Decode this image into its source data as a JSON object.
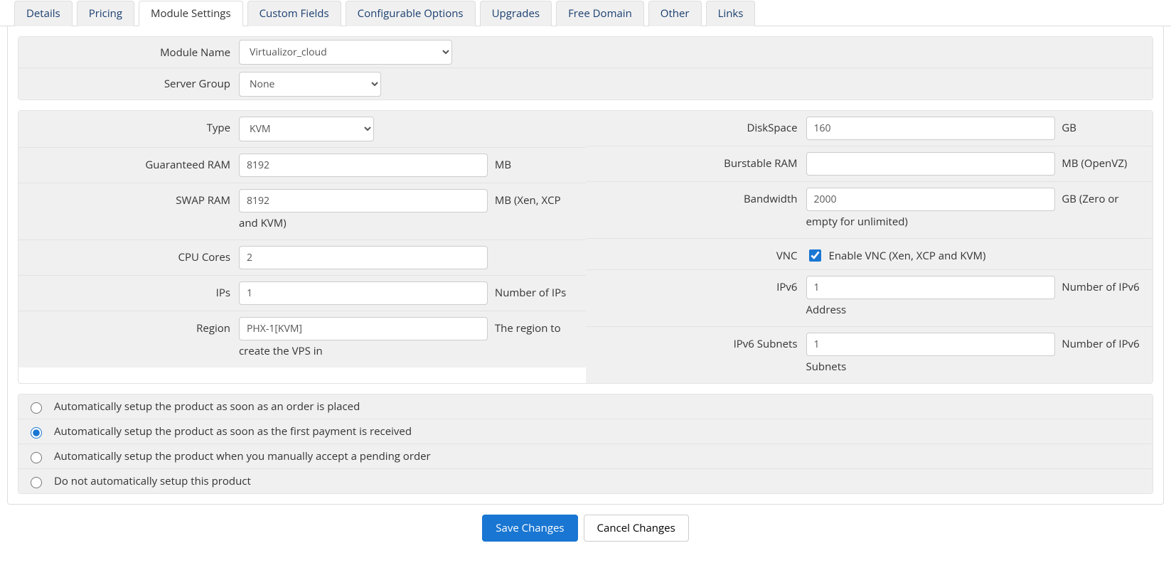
{
  "tabs": {
    "details": "Details",
    "pricing": "Pricing",
    "module": "Module Settings",
    "custom": "Custom Fields",
    "config": "Configurable Options",
    "upgrades": "Upgrades",
    "free_domain": "Free Domain",
    "other": "Other",
    "links": "Links"
  },
  "top": {
    "module_name_label": "Module Name",
    "module_name_value": "Virtualizor_cloud",
    "server_group_label": "Server Group",
    "server_group_value": "None"
  },
  "left": {
    "type_label": "Type",
    "type_value": "KVM",
    "gram_label": "Guaranteed RAM",
    "gram_value": "8192",
    "gram_suffix": "MB",
    "swap_label": "SWAP RAM",
    "swap_value": "8192",
    "swap_suffix": "MB (Xen, XCP and KVM)",
    "cpu_label": "CPU Cores",
    "cpu_value": "2",
    "ips_label": "IPs",
    "ips_value": "1",
    "ips_suffix": "Number of IPs",
    "region_label": "Region",
    "region_value": "PHX-1[KVM]",
    "region_suffix": "The region to create the VPS in"
  },
  "right": {
    "disk_label": "DiskSpace",
    "disk_value": "160",
    "disk_suffix": "GB",
    "bram_label": "Burstable RAM",
    "bram_value": "",
    "bram_suffix": "MB (OpenVZ)",
    "bw_label": "Bandwidth",
    "bw_value": "2000",
    "bw_suffix": "GB (Zero or empty for unlimited)",
    "vnc_label": "VNC",
    "vnc_checkbox_label": "Enable VNC (Xen, XCP and KVM)",
    "ipv6_label": "IPv6",
    "ipv6_value": "1",
    "ipv6_suffix": "Number of IPv6 Address",
    "ipv6s_label": "IPv6 Subnets",
    "ipv6s_value": "1",
    "ipv6s_suffix": "Number of IPv6 Subnets"
  },
  "radios": {
    "r1": "Automatically setup the product as soon as an order is placed",
    "r2": "Automatically setup the product as soon as the first payment is received",
    "r3": "Automatically setup the product when you manually accept a pending order",
    "r4": "Do not automatically setup this product"
  },
  "footer": {
    "save": "Save Changes",
    "cancel": "Cancel Changes"
  }
}
